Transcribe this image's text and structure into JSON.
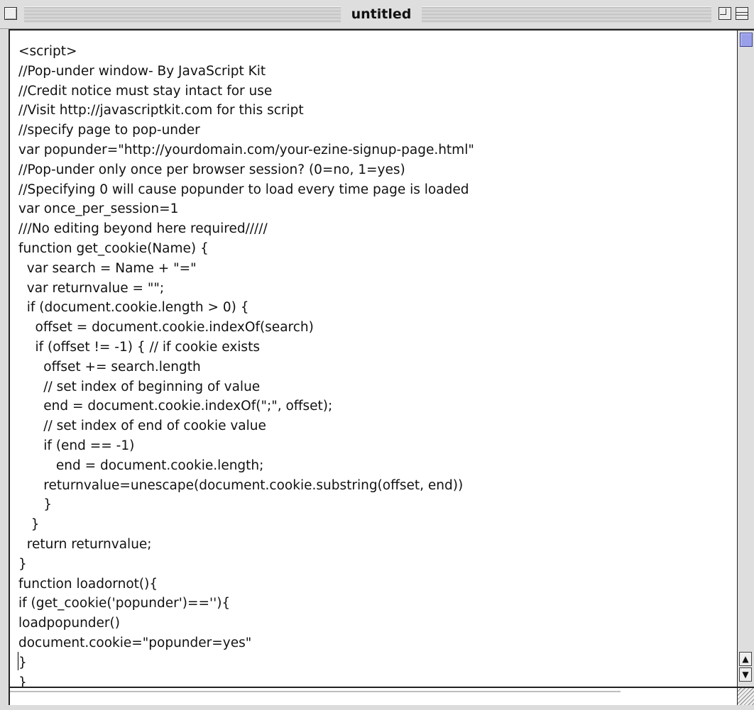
{
  "window": {
    "title": "untitled"
  },
  "editor": {
    "lines": [
      "<script>",
      "//Pop-under window- By JavaScript Kit",
      "//Credit notice must stay intact for use",
      "//Visit http://javascriptkit.com for this script",
      "//specify page to pop-under",
      "var popunder=\"http://yourdomain.com/your-ezine-signup-page.html\"",
      "//Pop-under only once per browser session? (0=no, 1=yes)",
      "//Specifying 0 will cause popunder to load every time page is loaded",
      "var once_per_session=1",
      "///No editing beyond here required/////",
      "function get_cookie(Name) {",
      "  var search = Name + \"=\"",
      "  var returnvalue = \"\";",
      "  if (document.cookie.length > 0) {",
      "    offset = document.cookie.indexOf(search)",
      "    if (offset != -1) { // if cookie exists",
      "      offset += search.length",
      "      // set index of beginning of value",
      "      end = document.cookie.indexOf(\";\", offset);",
      "      // set index of end of cookie value",
      "      if (end == -1)",
      "         end = document.cookie.length;",
      "      returnvalue=unescape(document.cookie.substring(offset, end))",
      "      }",
      "   }",
      "  return returnvalue;",
      "}",
      "function loadornot(){",
      "if (get_cookie('popunder')==''){",
      "loadpopunder()",
      "document.cookie=\"popunder=yes\"",
      "}",
      "}"
    ]
  },
  "colors": {
    "chrome": "#dedede",
    "scroll_thumb": "#9aa0e8",
    "text": "#111111"
  }
}
